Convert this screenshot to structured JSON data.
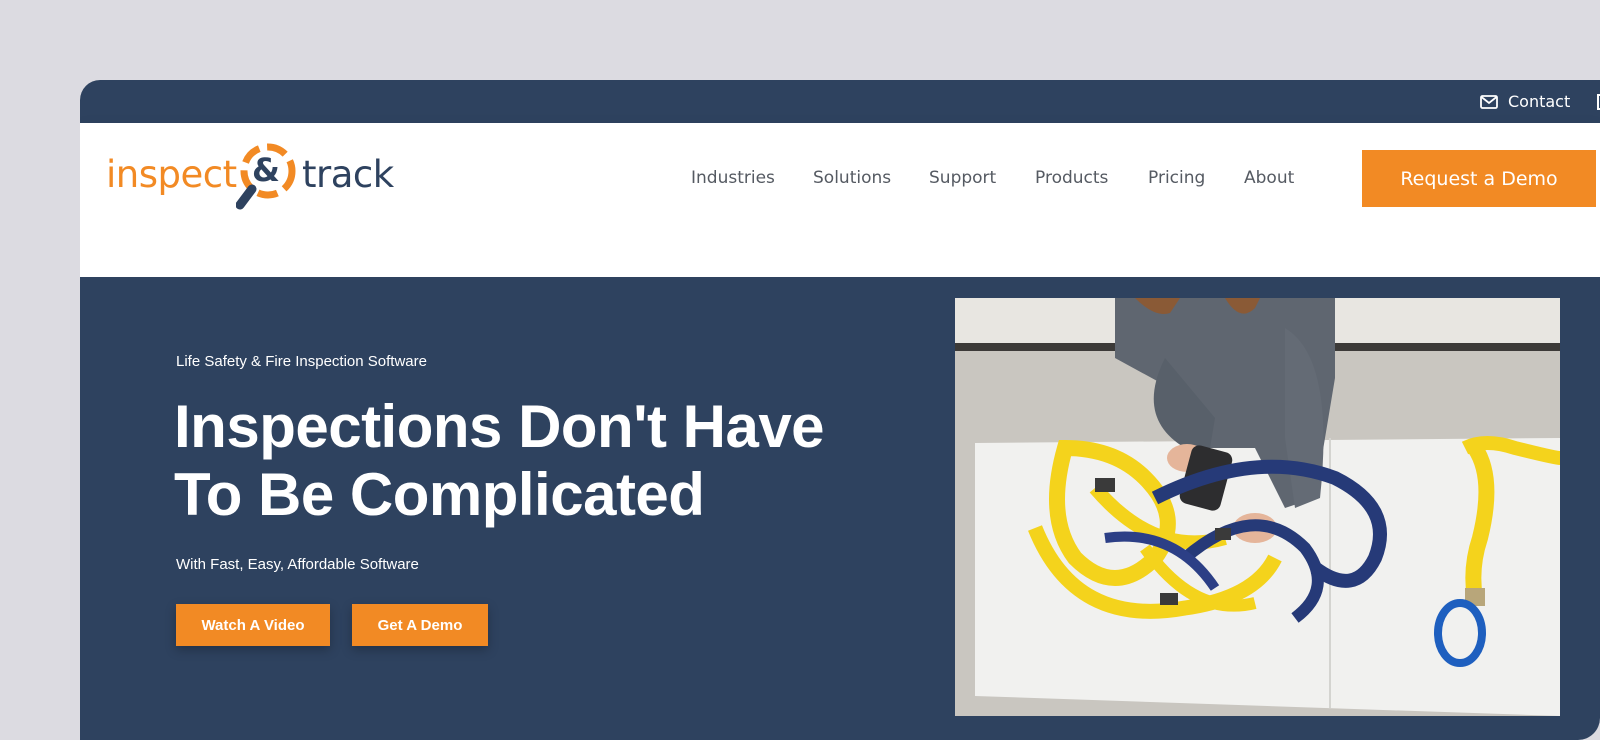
{
  "topbar": {
    "contact_label": "Contact",
    "contact_icon": "envelope-icon"
  },
  "header": {
    "logo": {
      "left_text": "inspect",
      "right_text": "track",
      "mark": "& magnifier",
      "brand_orange": "#f28a24",
      "brand_navy": "#2e425f"
    },
    "nav": [
      "Industries",
      "Solutions",
      "Support",
      "Products",
      "Pricing",
      "About"
    ],
    "cta_label": "Request a Demo"
  },
  "hero": {
    "eyebrow": "Life Safety & Fire Inspection Software",
    "headline_line1": "Inspections Don't Have",
    "headline_line2": "To Be Complicated",
    "subline": "With Fast, Easy, Affordable Software",
    "primary_button": "Watch A Video",
    "secondary_button": "Get A Demo",
    "image": "person inspecting yellow and navy safety harness with handheld scanner on white table"
  },
  "colors": {
    "navy": "#2e425f",
    "orange": "#f28a24",
    "page_bg": "#dcdbe1"
  }
}
